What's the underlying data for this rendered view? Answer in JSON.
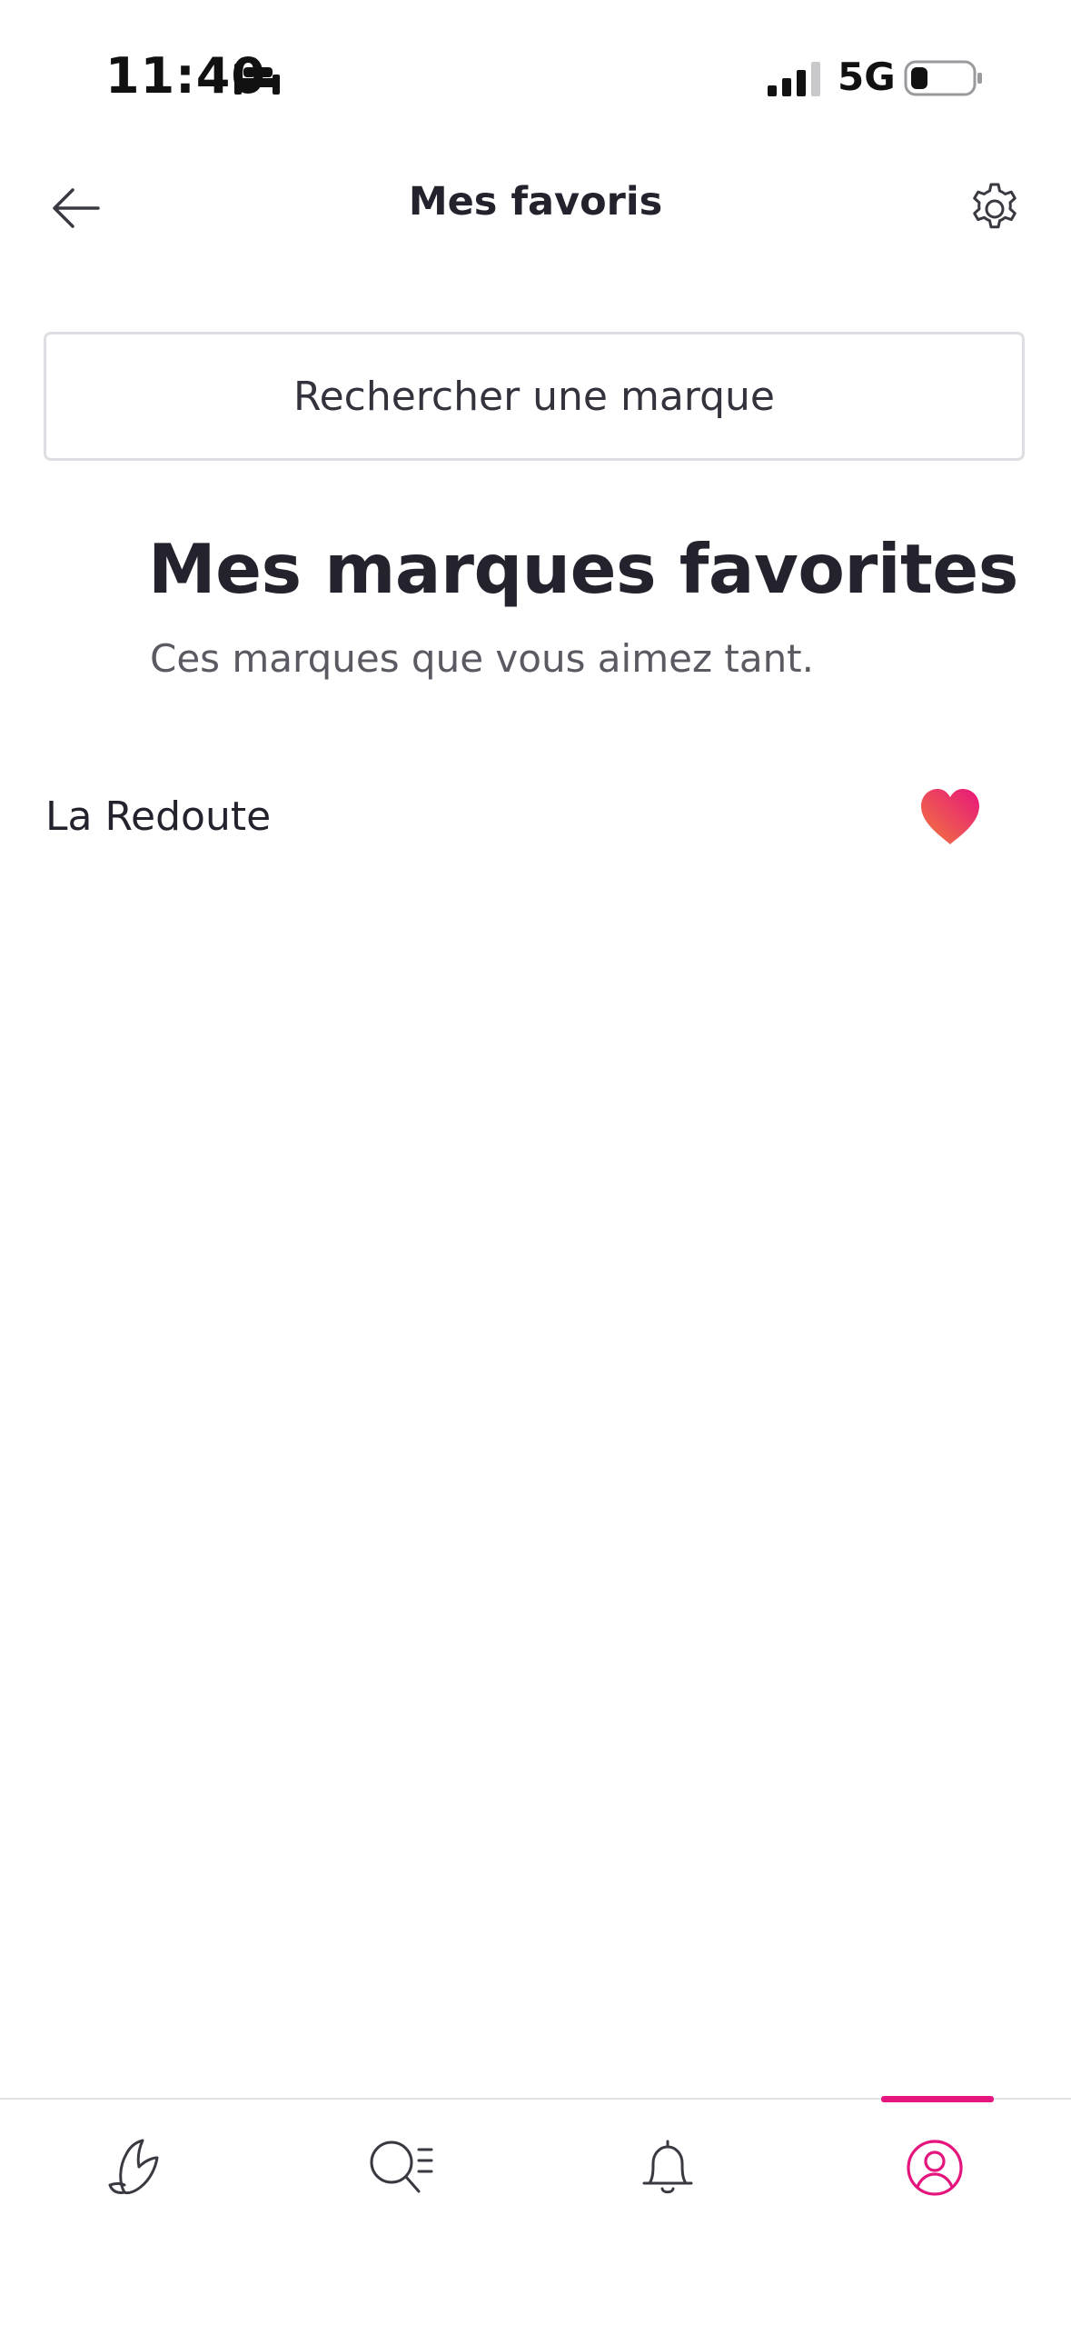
{
  "status_bar": {
    "time": "11:40",
    "network": "5G"
  },
  "header": {
    "title": "Mes favoris"
  },
  "search": {
    "label": "Rechercher une marque"
  },
  "favorites": {
    "title": "Mes marques favorites",
    "subtitle": "Ces marques que vous aimez tant.",
    "brands": [
      {
        "name": "La Redoute",
        "favorited": true
      }
    ]
  },
  "colors": {
    "accent": "#e5157e",
    "heart_start": "#f07a3c",
    "heart_end": "#e8167c",
    "text": "#24232d"
  },
  "icons": {
    "back": "arrow-left-icon",
    "settings": "gear-icon",
    "heart": "heart-icon",
    "nav": [
      "butterfly-icon",
      "search-list-icon",
      "bell-icon",
      "profile-icon"
    ]
  },
  "bottom_nav": {
    "active_index": 3
  }
}
